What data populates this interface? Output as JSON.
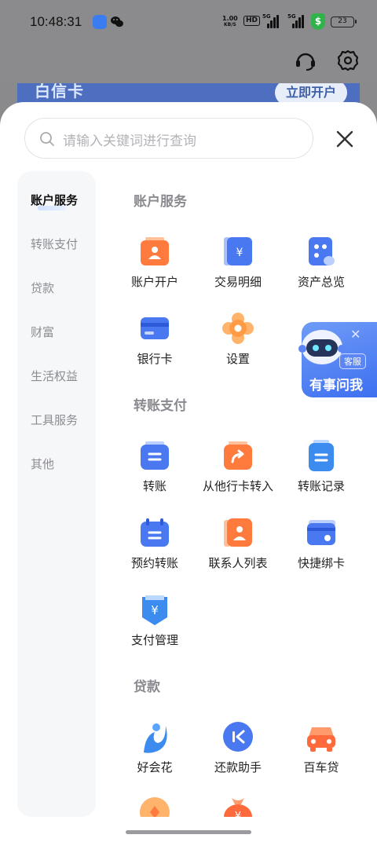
{
  "status_bar": {
    "time": "10:48:31",
    "net_speed": "1.00",
    "net_unit": "KB/S",
    "hd": "HD",
    "sig1": "5G",
    "sig2": "5G",
    "battery": "23"
  },
  "header": {
    "support_icon": "headset-icon",
    "settings_icon": "gear-icon"
  },
  "banner": {
    "text": "白信卡",
    "button": "立即开户"
  },
  "search": {
    "placeholder": "请输入关键词进行查询"
  },
  "sidebar": {
    "items": [
      {
        "label": "账户服务",
        "active": true
      },
      {
        "label": "转账支付"
      },
      {
        "label": "贷款"
      },
      {
        "label": "财富"
      },
      {
        "label": "生活权益"
      },
      {
        "label": "工具服务"
      },
      {
        "label": "其他"
      }
    ]
  },
  "sections": [
    {
      "title": "账户服务",
      "items": [
        {
          "label": "账户开户",
          "icon": "account-open-icon"
        },
        {
          "label": "交易明细",
          "icon": "transaction-detail-icon"
        },
        {
          "label": "资产总览",
          "icon": "asset-overview-icon"
        },
        {
          "label": "银行卡",
          "icon": "bank-card-icon"
        },
        {
          "label": "设置",
          "icon": "settings-flower-icon"
        }
      ]
    },
    {
      "title": "转账支付",
      "items": [
        {
          "label": "转账",
          "icon": "transfer-icon"
        },
        {
          "label": "从他行卡转入",
          "icon": "transfer-in-icon"
        },
        {
          "label": "转账记录",
          "icon": "transfer-record-icon"
        },
        {
          "label": "预约转账",
          "icon": "scheduled-transfer-icon"
        },
        {
          "label": "联系人列表",
          "icon": "contact-list-icon"
        },
        {
          "label": "快捷绑卡",
          "icon": "quick-bind-card-icon"
        },
        {
          "label": "支付管理",
          "icon": "payment-management-icon"
        }
      ]
    },
    {
      "title": "贷款",
      "items": [
        {
          "label": "好会花",
          "icon": "haohuihua-icon"
        },
        {
          "label": "还款助手",
          "icon": "repayment-assistant-icon"
        },
        {
          "label": "百车贷",
          "icon": "car-loan-icon"
        }
      ]
    }
  ],
  "floater": {
    "badge": "客服",
    "text": "有事问我"
  },
  "colors": {
    "orange": "#ff7a3d",
    "blue": "#4a78f0",
    "overlay": "#8b8b8d"
  }
}
